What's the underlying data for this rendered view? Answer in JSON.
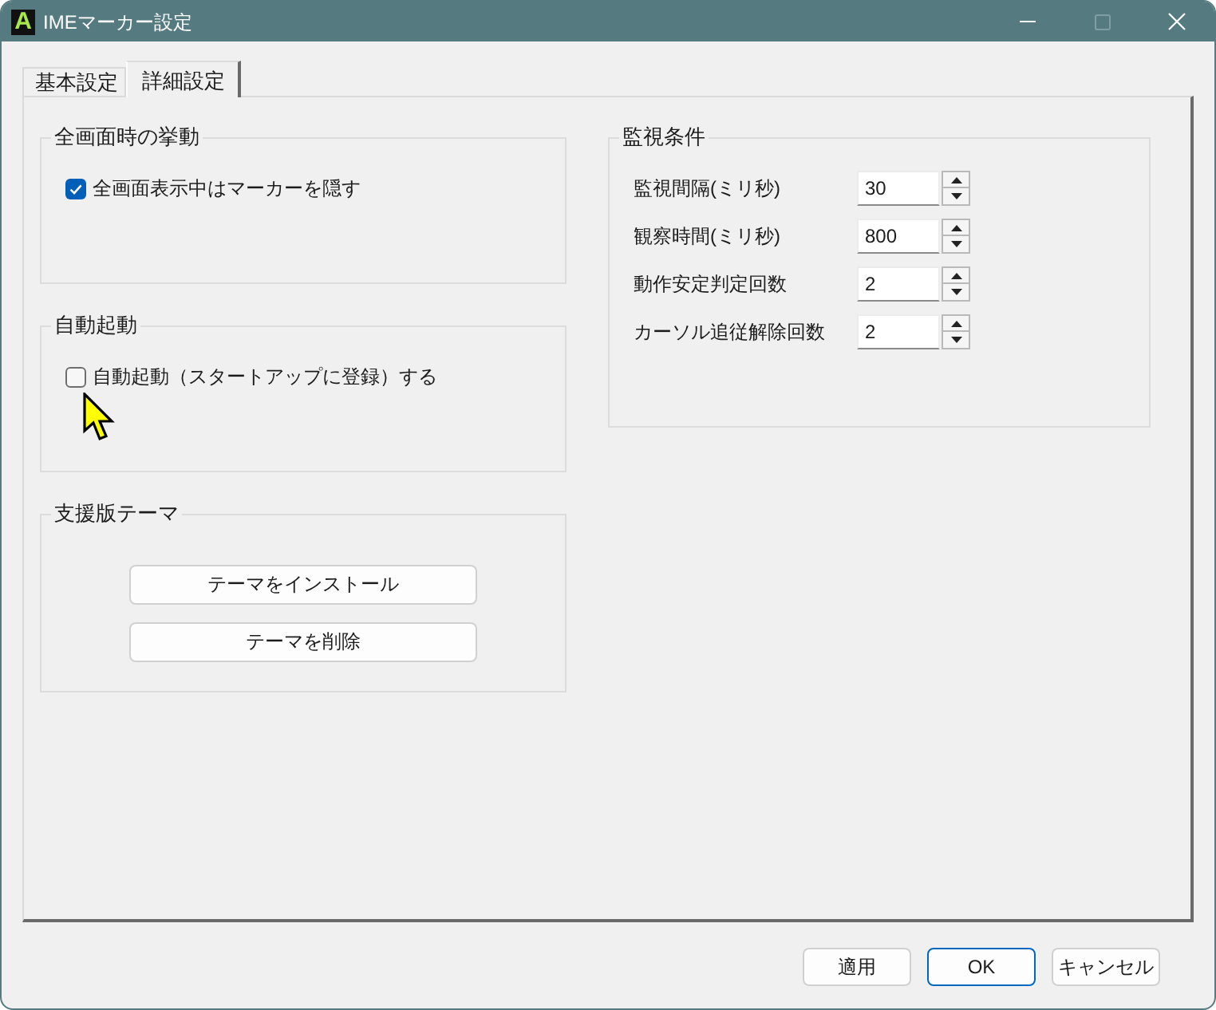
{
  "window": {
    "app_icon_text": "A",
    "title": "IMEマーカー設定",
    "maximize_disabled": true
  },
  "tabs": [
    {
      "label": "基本設定",
      "selected": false
    },
    {
      "label": "詳細設定",
      "selected": true
    }
  ],
  "left_groups": [
    {
      "title": "全画面時の挙動",
      "kind": "checkbox",
      "checkbox": {
        "label": "全画面表示中はマーカーを隠す",
        "checked": true
      }
    },
    {
      "title": "自動起動",
      "kind": "checkbox",
      "checkbox": {
        "label": "自動起動（スタートアップに登録）する",
        "checked": false
      }
    },
    {
      "title": "支援版テーマ",
      "kind": "buttons",
      "buttons": [
        "テーマをインストール",
        "テーマを削除"
      ]
    }
  ],
  "monitor_group": {
    "title": "監視条件",
    "fields": [
      {
        "label": "監視間隔(ミリ秒)",
        "value": "30"
      },
      {
        "label": "観察時間(ミリ秒)",
        "value": "800"
      },
      {
        "label": "動作安定判定回数",
        "value": "2"
      },
      {
        "label": "カーソル追従解除回数",
        "value": "2"
      }
    ]
  },
  "buttons": [
    {
      "label": "適用",
      "default": false
    },
    {
      "label": "OK",
      "default": true
    },
    {
      "label": "キャンセル",
      "default": false
    }
  ]
}
